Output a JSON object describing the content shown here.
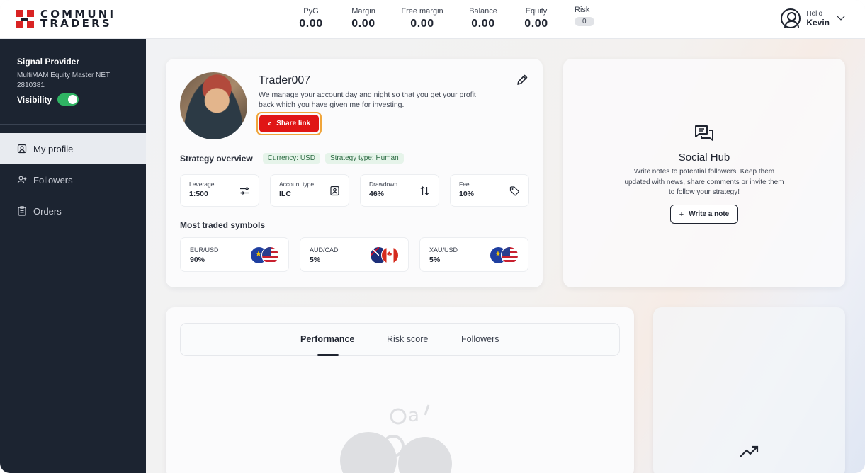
{
  "brand": {
    "line1": "COMMUNI",
    "line2": "TRADERS"
  },
  "stats": [
    {
      "label": "PyG",
      "value": "0.00"
    },
    {
      "label": "Margin",
      "value": "0.00"
    },
    {
      "label": "Free margin",
      "value": "0.00"
    },
    {
      "label": "Balance",
      "value": "0.00"
    },
    {
      "label": "Equity",
      "value": "0.00"
    }
  ],
  "risk": {
    "label": "Risk",
    "value": "0"
  },
  "user": {
    "greeting": "Hello",
    "name": "Kevin"
  },
  "sidebar": {
    "title": "Signal Provider",
    "account_name": "MultiMAM Equity Master NET",
    "account_number": "2810381",
    "visibility_label": "Visibility",
    "visibility_on": true,
    "items": [
      {
        "label": "My profile",
        "icon": "profile-icon",
        "active": true
      },
      {
        "label": "Followers",
        "icon": "add-user-icon",
        "active": false
      },
      {
        "label": "Orders",
        "icon": "clipboard-icon",
        "active": false
      }
    ]
  },
  "profile": {
    "name": "Trader007",
    "description": "We manage your account day and night so that you get your profit back which you have given me for investing.",
    "share_label": "Share link",
    "strategy_title": "Strategy overview",
    "tags": [
      "Currency: USD",
      "Strategy type: Human"
    ],
    "metrics": [
      {
        "label": "Leverage",
        "value": "1:500",
        "icon": "sliders-icon"
      },
      {
        "label": "Account type",
        "value": "ILC",
        "icon": "id-card-icon"
      },
      {
        "label": "Drawdown",
        "value": "46%",
        "icon": "up-down-arrows-icon"
      },
      {
        "label": "Fee",
        "value": "10%",
        "icon": "tag-icon"
      }
    ],
    "symbols_title": "Most traded symbols",
    "symbols": [
      {
        "label": "EUR/USD",
        "value": "90%"
      },
      {
        "label": "AUD/CAD",
        "value": "5%"
      },
      {
        "label": "XAU/USD",
        "value": "5%"
      }
    ]
  },
  "social": {
    "title": "Social Hub",
    "description": "Write notes to potential followers. Keep them updated with news, share comments or invite them to follow your strategy!",
    "button_label": "Write a note"
  },
  "performance": {
    "tabs": [
      "Performance",
      "Risk score",
      "Followers"
    ],
    "active_tab": "Performance"
  },
  "colors": {
    "accent": "#e01515",
    "sidebar": "#1c2431",
    "toggle": "#2fb463",
    "focus": "#f0a53a"
  }
}
